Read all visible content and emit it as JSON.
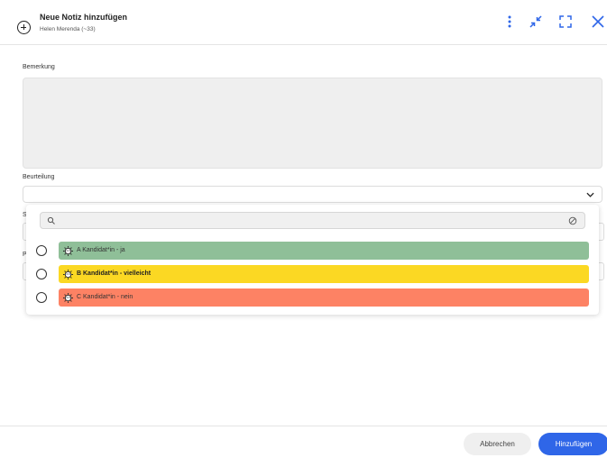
{
  "header": {
    "title": "Neue Notiz hinzufügen",
    "subtitle": "Helen Merenda (~33)",
    "icons": [
      "add-circle-icon",
      "more-vertical-icon",
      "collapse-icon",
      "expand-icon",
      "close-icon"
    ]
  },
  "form": {
    "remark_label": "Bemerkung",
    "remark_value": "",
    "rating_label": "Beurteilung",
    "rating_value": "",
    "hidden_label_s": "S",
    "hidden_label_p": "P"
  },
  "dropdown": {
    "search_placeholder": "",
    "options": [
      {
        "label": "A Kandidat*in - ja",
        "color": "#8fbf98",
        "bold": false
      },
      {
        "label": "B Kandidat*in - vielleicht",
        "color": "#fbd823",
        "bold": true
      },
      {
        "label": "C Kandidat*in - nein",
        "color": "#fd8264",
        "bold": false
      }
    ]
  },
  "footer": {
    "cancel_label": "Abbrechen",
    "submit_label": "Hinzufügen",
    "submit_color": "#2f66e8"
  }
}
